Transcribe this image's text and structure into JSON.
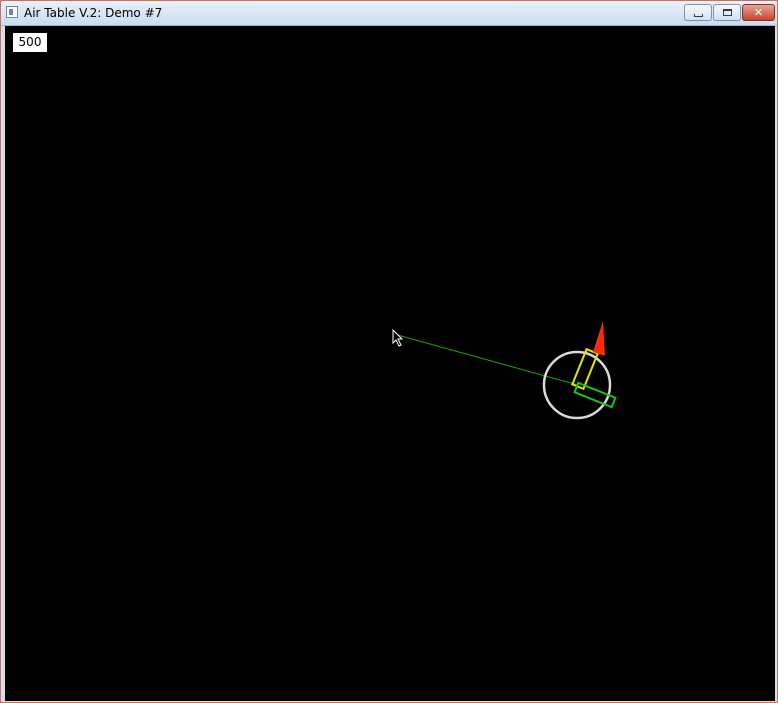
{
  "window": {
    "title": "Air Table V.2: Demo #7"
  },
  "controls": {
    "minimize": "minimize",
    "maximize": "maximize",
    "close": "close"
  },
  "hud": {
    "counter": "500"
  },
  "colors": {
    "background": "#000000",
    "trajectory": "#1aa61a",
    "ring": "#d9d9d9",
    "thruster_yellow": "#e6e600",
    "thruster_green": "#19c419",
    "flame": "#ff2a00",
    "cursor": "#ffffff"
  },
  "icons": [
    "app-icon",
    "minimize-icon",
    "maximize-icon",
    "close-icon",
    "mouse-cursor-icon"
  ]
}
